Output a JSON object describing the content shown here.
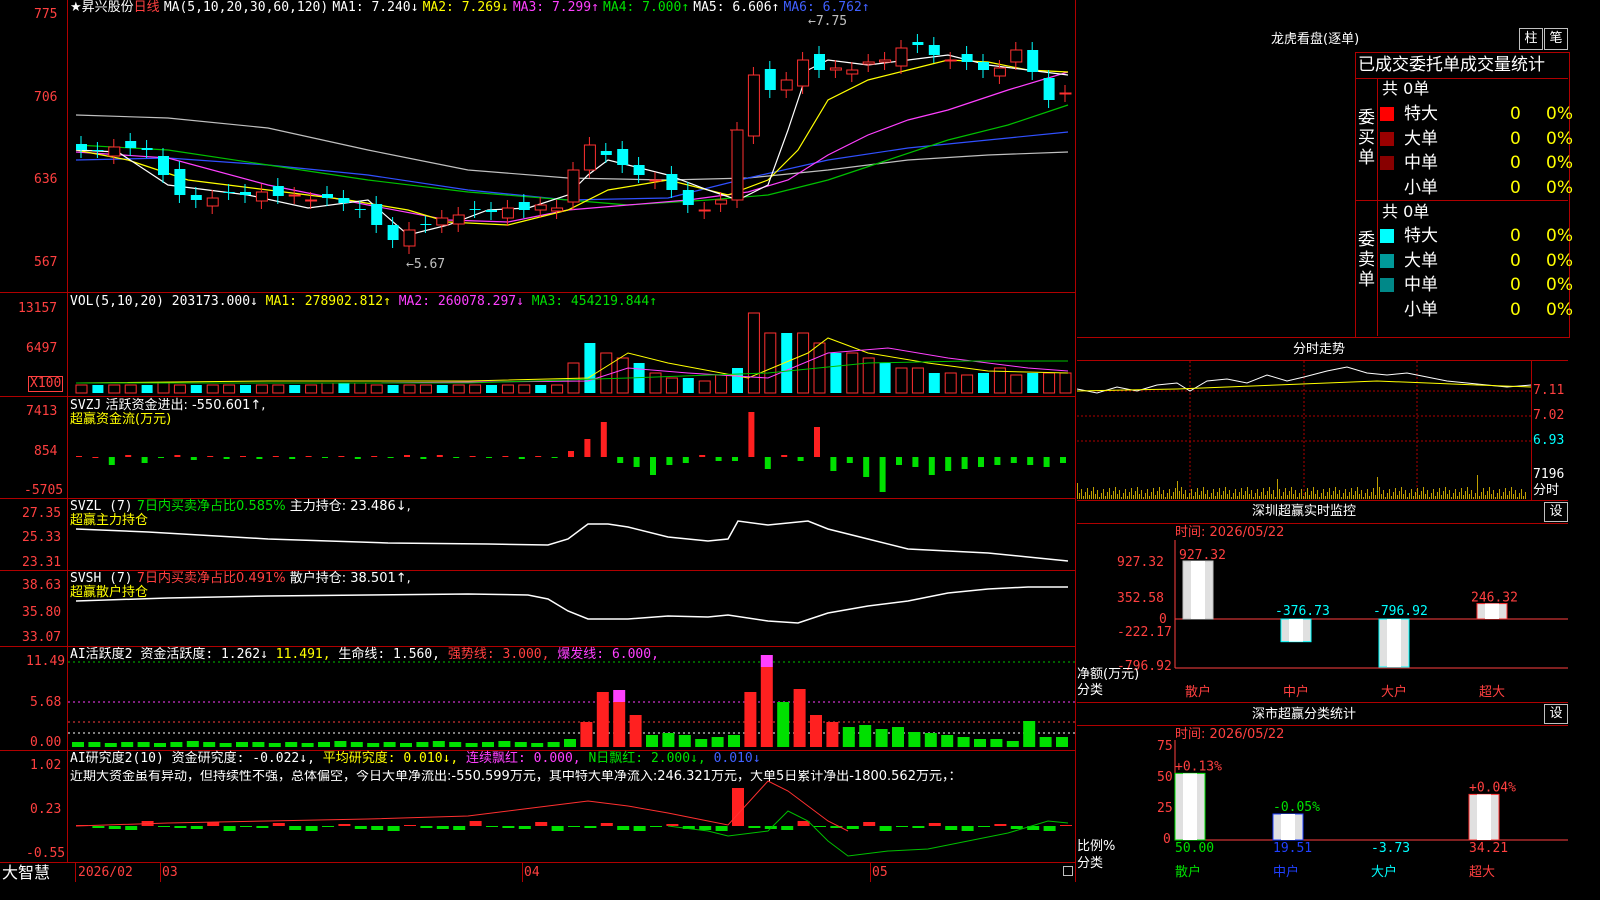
{
  "header": {
    "star": "★",
    "stock_name": "昇兴股份",
    "period": "日线",
    "ma_title": "MA(5,10,20,30,60,120)",
    "ma1": "MA1: 7.240↓",
    "ma2": "MA2: 7.269↓",
    "ma3": "MA3: 7.299↑",
    "ma4": "MA4: 7.000↑",
    "ma5": "MA5: 6.606↑",
    "ma6": "MA6: 6.762↑"
  },
  "price_axis": [
    "775",
    "706",
    "636",
    "567"
  ],
  "price_annotations": {
    "high": "7.75",
    "low": "5.67"
  },
  "vol": {
    "title": "VOL(5,10,20)",
    "value": "203173.000↓",
    "ma1": "MA1: 278902.812↑",
    "ma2": "MA2: 260078.297↓",
    "ma3": "MA3: 454219.844↑",
    "axis": [
      "13157",
      "6497",
      "X100"
    ]
  },
  "svzj": {
    "title": "SVZJ",
    "label": "活跃资金进出: -550.601↑,",
    "sub": "超赢资金流(万元)",
    "axis": [
      "7413",
      "854",
      "-5705"
    ]
  },
  "svzl": {
    "title": "SVZL (7)",
    "label1": "7日内买卖净占比0.585%",
    "label2": "主力持仓: 23.486↓,",
    "sub": "超赢主力持仓",
    "axis": [
      "27.35",
      "25.33",
      "23.31"
    ]
  },
  "svsh": {
    "title": "SVSH (7)",
    "label1": "7日内买卖净占比0.491%",
    "label2": "散户持仓: 38.501↑,",
    "sub": "超赢散户持仓",
    "axis": [
      "38.63",
      "35.80",
      "33.07"
    ]
  },
  "ai1": {
    "title": "AI活跃度2",
    "label1": "资金活跃度: 1.262↓",
    "label2": "11.491,",
    "label3": "生命线: 1.560,",
    "label4": "强势线: 3.000,",
    "label5": "爆发线: 6.000,",
    "axis": [
      "11.49",
      "5.68",
      "0.00"
    ]
  },
  "ai2": {
    "title": "AI研究度2(10)",
    "label1": "资金研究度: -0.022↓,",
    "label2": "平均研究度: 0.010↓,",
    "label3": "连续飘红: 0.000,",
    "label4": "N日飘红: 2.000↓,",
    "label5": "0.010↓",
    "comment": "近期大资金虽有异动，但持续性不强，总体偏空，今日大单净流出:-550.599万元，其中特大单净流入:246.321万元，大单5日累计净出-1800.562万元，：",
    "axis": [
      "1.02",
      "0.23",
      "-0.55"
    ]
  },
  "bottom": {
    "brand": "大智慧",
    "dates": [
      "2026/02",
      "03",
      "04",
      "05"
    ]
  },
  "right": {
    "lhb_title": "龙虎看盘(逐单)",
    "btn_zhu": "柱",
    "btn_bi": "笔",
    "stat_title": "已成交委托单成交量统计",
    "buy_label": "委买单",
    "sell_label": "委卖单",
    "buy_total": "共 0单",
    "sell_total": "共 0单",
    "buy_rows": [
      {
        "name": "特大",
        "count": "0",
        "pct": "0%"
      },
      {
        "name": "大单",
        "count": "0",
        "pct": "0%"
      },
      {
        "name": "中单",
        "count": "0",
        "pct": "0%"
      },
      {
        "name": "小单",
        "count": "0",
        "pct": "0%"
      }
    ],
    "sell_rows": [
      {
        "name": "特大",
        "count": "0",
        "pct": "0%"
      },
      {
        "name": "大单",
        "count": "0",
        "pct": "0%"
      },
      {
        "name": "中单",
        "count": "0",
        "pct": "0%"
      },
      {
        "name": "小单",
        "count": "0",
        "pct": "0%"
      }
    ],
    "fs_title": "分时走势",
    "fs_axis": [
      "7.11",
      "7.02",
      "6.93",
      "7196",
      "分时"
    ],
    "sz_title": "深圳超赢实时监控",
    "sz_btn": "设",
    "sz_time": "时间: 2026/05/22",
    "sz_axis": [
      "927.32",
      "352.58",
      "0",
      "-222.17",
      "-796.92"
    ],
    "sz_values": [
      {
        "cat": "散户",
        "value": "927.32"
      },
      {
        "cat": "中户",
        "value": "-376.73"
      },
      {
        "cat": "大户",
        "value": "-796.92"
      },
      {
        "cat": "超大",
        "value": "246.32"
      }
    ],
    "sz_ylab": "净额(万元)",
    "sz_xlab": "分类",
    "fl_title": "深市超赢分类统计",
    "fl_btn": "设",
    "fl_time": "时间: 2026/05/22",
    "fl_axis": [
      "75",
      "50",
      "25",
      "0"
    ],
    "fl_values": [
      {
        "cat": "散户",
        "pct": "+0.13%",
        "value": "50.00"
      },
      {
        "cat": "中户",
        "pct": "-0.05%",
        "value": "19.51"
      },
      {
        "cat": "大户",
        "pct": "",
        "value": "-3.73"
      },
      {
        "cat": "超大",
        "pct": "+0.04%",
        "value": "34.21"
      }
    ],
    "fl_ylab": "比例%",
    "fl_xlab": "分类"
  },
  "colors": {
    "up": "#ff3030",
    "down": "#00ffff",
    "grid": "#b00000"
  }
}
